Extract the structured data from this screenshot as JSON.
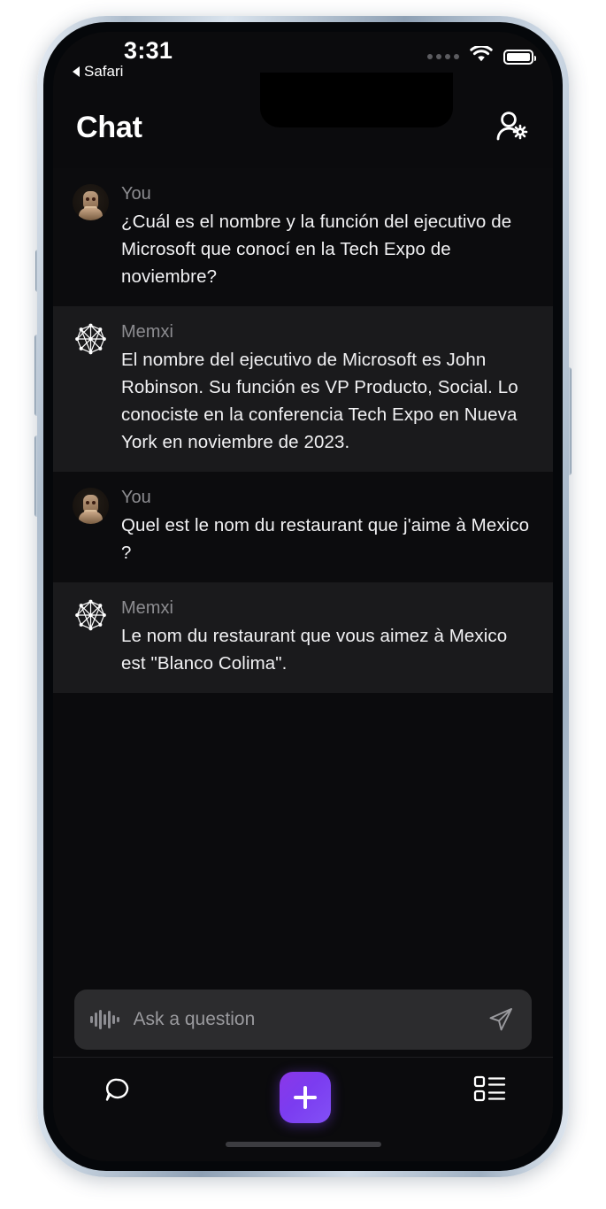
{
  "status_bar": {
    "time": "3:31",
    "back_label": "Safari",
    "back_icon": "triangle-left-icon",
    "cellular_icon": "cellular-dots-icon",
    "wifi_icon": "wifi-icon",
    "battery_icon": "battery-full-icon"
  },
  "header": {
    "title": "Chat",
    "account_settings_icon": "person-gear-icon"
  },
  "chat": {
    "messages": [
      {
        "sender": "You",
        "role": "user",
        "avatar_icon": "user-avatar",
        "text": "¿Cuál es el nombre y la función del ejecutivo de Microsoft que conocí en la Tech Expo de noviembre?"
      },
      {
        "sender": "Memxi",
        "role": "assistant",
        "avatar_icon": "memxi-network-logo-icon",
        "text": "El nombre del ejecutivo de Microsoft es John Robinson. Su función es VP Producto, Social. Lo conociste en la conferencia Tech Expo en Nueva York en noviembre de 2023."
      },
      {
        "sender": "You",
        "role": "user",
        "avatar_icon": "user-avatar",
        "text": "Quel est le nom du restaurant que j'aime à Mexico ?"
      },
      {
        "sender": "Memxi",
        "role": "assistant",
        "avatar_icon": "memxi-network-logo-icon",
        "text": "Le nom du restaurant que vous aimez à Mexico est \"Blanco Colima\"."
      }
    ]
  },
  "composer": {
    "placeholder": "Ask a question",
    "value": "",
    "voice_icon": "waveform-icon",
    "send_icon": "send-paper-plane-icon"
  },
  "tabbar": {
    "chat_tab_icon": "chat-bubble-icon",
    "add_button_icon": "plus-icon",
    "library_tab_icon": "list-grid-icon",
    "accent_color": "#7b3cf0"
  },
  "colors": {
    "screen_background": "#0b0b0d",
    "user_row_background": "#0c0c0e",
    "assistant_row_background": "#1a1a1c",
    "primary_text": "#f2f2f4",
    "secondary_text": "#8c8c90",
    "composer_background": "#2c2c2e",
    "accent": "#7b3cf0"
  }
}
